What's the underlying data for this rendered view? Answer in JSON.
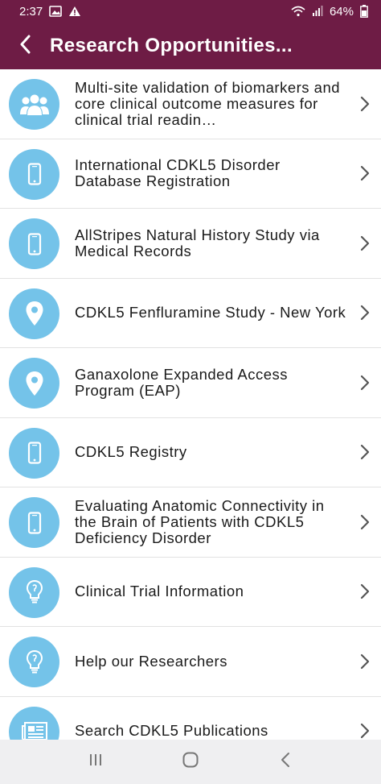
{
  "status_bar": {
    "time": "2:37",
    "battery": "64%",
    "icons": [
      "gallery-icon",
      "warning-icon",
      "wifi-icon",
      "signal-icon",
      "battery-icon"
    ]
  },
  "app_bar": {
    "title": "Research Opportunities...",
    "back_icon": "back-chevron-icon",
    "background": "#6e1c45"
  },
  "colors": {
    "accent_circle": "#74c3e9",
    "text": "#1a1a1a",
    "divider": "#e2e2e2"
  },
  "items": [
    {
      "icon": "group-icon",
      "label": "Multi-site validation of biomarkers and core clinical outcome measures for clinical trial readin…"
    },
    {
      "icon": "mobile-phone-icon",
      "label": "International CDKL5 Disorder Database Registration"
    },
    {
      "icon": "mobile-phone-icon",
      "label": "AllStripes Natural History Study via Medical Records"
    },
    {
      "icon": "location-pin-icon",
      "label": "CDKL5 Fenfluramine Study - New York"
    },
    {
      "icon": "location-pin-icon",
      "label": "Ganaxolone Expanded Access Program (EAP)"
    },
    {
      "icon": "mobile-phone-icon",
      "label": "CDKL5 Registry"
    },
    {
      "icon": "mobile-phone-icon",
      "label": "Evaluating Anatomic Connectivity in the Brain of Patients with CDKL5 Deficiency Disorder"
    },
    {
      "icon": "lightbulb-icon",
      "label": "Clinical Trial Information"
    },
    {
      "icon": "lightbulb-icon",
      "label": "Help our Researchers"
    },
    {
      "icon": "newspaper-icon",
      "label": "Search CDKL5 Publications"
    }
  ],
  "nav_bar": {
    "buttons": [
      "recent-apps-icon",
      "home-icon",
      "back-icon"
    ]
  }
}
